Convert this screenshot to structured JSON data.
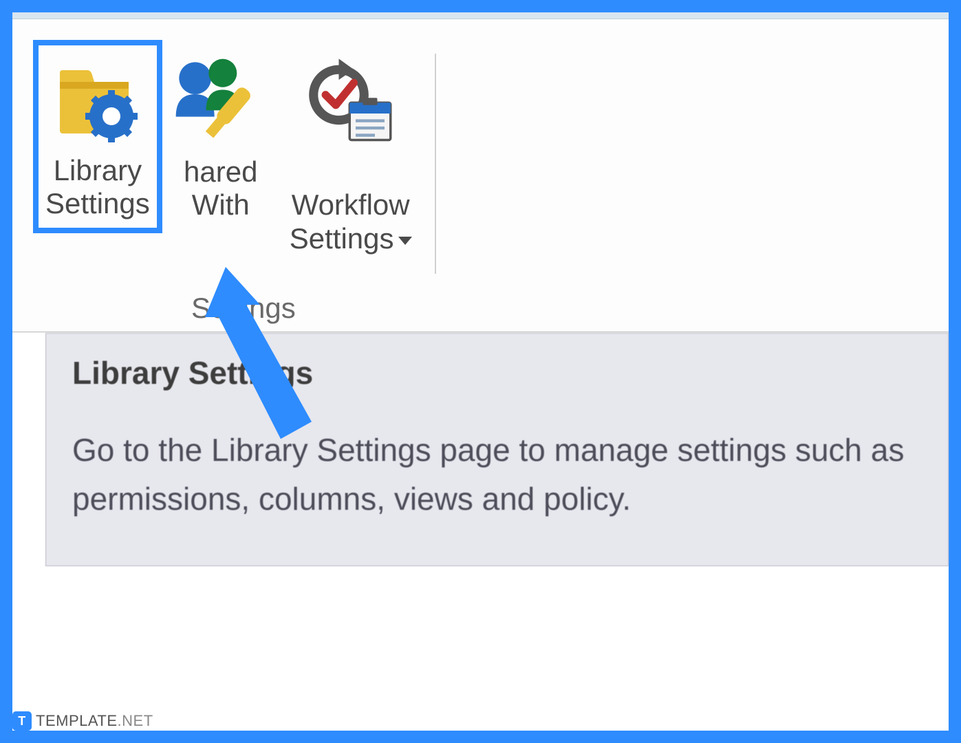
{
  "ribbon": {
    "group_label": "Settings",
    "items": [
      {
        "label": "Library\nSettings",
        "has_dropdown": false,
        "highlighted": true,
        "icon": "library-settings-icon"
      },
      {
        "label": "hared\nWith",
        "has_dropdown": false,
        "highlighted": false,
        "icon": "shared-with-icon"
      },
      {
        "label": "Workflow\nSettings",
        "has_dropdown": true,
        "highlighted": false,
        "icon": "workflow-settings-icon"
      }
    ]
  },
  "tooltip": {
    "title": "Library Settings",
    "description": "Go to the Library Settings page to manage settings such as permissions, columns, views and policy."
  },
  "watermark": {
    "brand": "TEMPLATE",
    "suffix": ".NET",
    "icon_letter": "T"
  }
}
